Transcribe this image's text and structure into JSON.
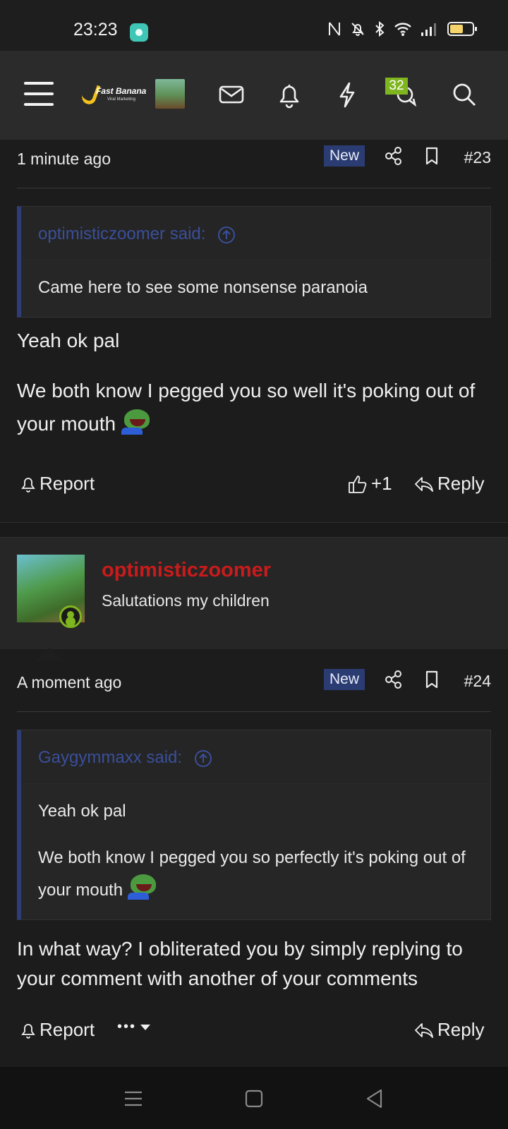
{
  "status_bar": {
    "time": "23:23",
    "icons": [
      "nfc-icon",
      "mute-icon",
      "bluetooth-icon",
      "wifi-icon",
      "signal-icon",
      "battery-icon"
    ]
  },
  "header": {
    "logo_text": "Fast Banana",
    "logo_subtext": "Viral Marketing",
    "notification_count": "32",
    "icons": [
      "menu-icon",
      "mail-icon",
      "bell-icon",
      "lightning-icon",
      "chat-icon",
      "search-icon"
    ]
  },
  "posts": [
    {
      "time": "1 minute ago",
      "new_label": "New",
      "number": "#23",
      "quote": {
        "author_label": "optimisticzoomer said:",
        "lines": [
          "Came here to see some nonsense paranoia"
        ]
      },
      "paragraphs": [
        "Yeah ok pal",
        "We both know I pegged you so well it's poking out of your mouth"
      ],
      "report_label": "Report",
      "like_label": "+1",
      "reply_label": "Reply"
    },
    {
      "user": {
        "name": "optimisticzoomer",
        "title": "Salutations my children"
      },
      "time": "A moment ago",
      "new_label": "New",
      "number": "#24",
      "quote": {
        "author_label": "Gaygymmaxx said:",
        "lines": [
          "Yeah ok pal",
          "We both know I pegged you so perfectly it's poking out of your mouth"
        ]
      },
      "paragraphs": [
        "In what way? I obliterated you by simply replying to your comment with another of your comments"
      ],
      "report_label": "Report",
      "more_label": "•••",
      "reply_label": "Reply"
    }
  ],
  "colors": {
    "background": "#1c1c1c",
    "header": "#2b2b2b",
    "new_badge": "#2b3c73",
    "quote_author": "#3a4f9a",
    "username": "#c91b1b",
    "badge": "#7fb51f"
  }
}
